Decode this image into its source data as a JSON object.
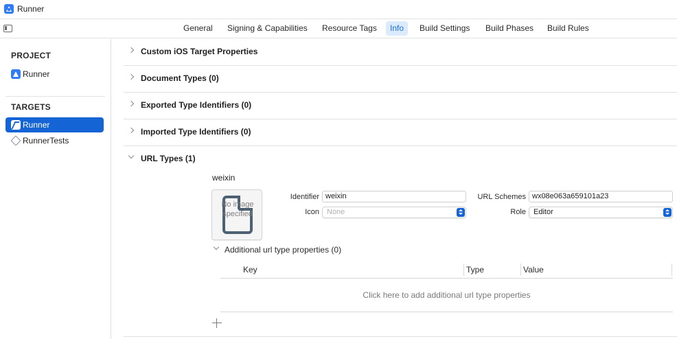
{
  "window": {
    "title": "Runner"
  },
  "tabs": [
    {
      "label": "General",
      "active": false
    },
    {
      "label": "Signing & Capabilities",
      "active": false
    },
    {
      "label": "Resource Tags",
      "active": false
    },
    {
      "label": "Info",
      "active": true
    },
    {
      "label": "Build Settings",
      "active": false
    },
    {
      "label": "Build Phases",
      "active": false
    },
    {
      "label": "Build Rules",
      "active": false
    }
  ],
  "sidebar": {
    "project_header": "PROJECT",
    "project_items": [
      {
        "label": "Runner",
        "icon": "xcode-project-icon"
      }
    ],
    "targets_header": "TARGETS",
    "target_items": [
      {
        "label": "Runner",
        "icon": "flutter-icon",
        "selected": true
      },
      {
        "label": "RunnerTests",
        "icon": "test-target-icon",
        "selected": false
      }
    ]
  },
  "sections": [
    {
      "title": "Custom iOS Target Properties",
      "expanded": false
    },
    {
      "title": "Document Types (0)",
      "expanded": false
    },
    {
      "title": "Exported Type Identifiers (0)",
      "expanded": false
    },
    {
      "title": "Imported Type Identifiers (0)",
      "expanded": false
    },
    {
      "title": "URL Types (1)",
      "expanded": true
    }
  ],
  "url_type": {
    "name": "weixin",
    "image_placeholder": "No image specified",
    "identifier_label": "Identifier",
    "identifier_value": "weixin",
    "icon_label": "Icon",
    "icon_placeholder": "None",
    "url_schemes_label": "URL Schemes",
    "url_schemes_value": "wx08e063a659101a23",
    "role_label": "Role",
    "role_value": "Editor",
    "additional_props_label": "Additional url type properties (0)",
    "table": {
      "columns": [
        "Key",
        "Type",
        "Value"
      ],
      "empty_hint": "Click here to add additional url type properties"
    }
  },
  "colors": {
    "accent": "#1464d6",
    "active_tab_bg": "#dcebfc",
    "active_tab_text": "#1a6fe0"
  }
}
